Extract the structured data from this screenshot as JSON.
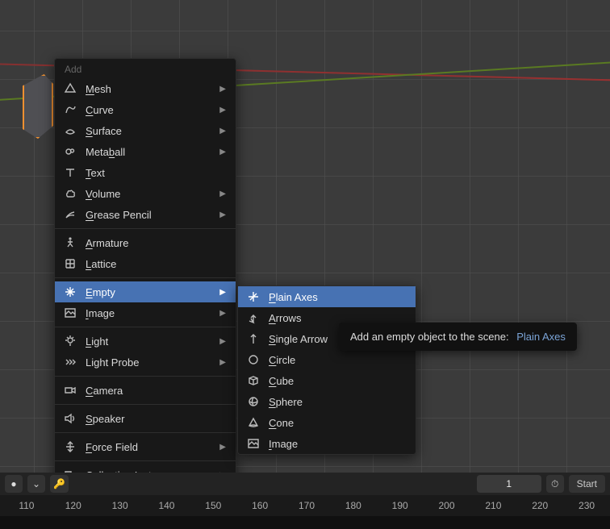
{
  "menu": {
    "title": "Add",
    "groups": [
      [
        {
          "id": "mesh",
          "label": "Mesh",
          "accel": "M",
          "icon": "mesh",
          "submenu": true
        },
        {
          "id": "curve",
          "label": "Curve",
          "accel": "C",
          "icon": "curve",
          "submenu": true
        },
        {
          "id": "surface",
          "label": "Surface",
          "accel": "S",
          "icon": "surface",
          "submenu": true
        },
        {
          "id": "metaball",
          "label": "Metaball",
          "accel": "b",
          "icon": "metaball",
          "submenu": true
        },
        {
          "id": "text",
          "label": "Text",
          "accel": "T",
          "icon": "text",
          "submenu": false
        },
        {
          "id": "volume",
          "label": "Volume",
          "accel": "V",
          "icon": "volume",
          "submenu": true
        },
        {
          "id": "grease",
          "label": "Grease Pencil",
          "accel": "G",
          "icon": "grease",
          "submenu": true
        }
      ],
      [
        {
          "id": "armature",
          "label": "Armature",
          "accel": "A",
          "icon": "armature",
          "submenu": false
        },
        {
          "id": "lattice",
          "label": "Lattice",
          "accel": "L",
          "icon": "lattice",
          "submenu": false
        }
      ],
      [
        {
          "id": "empty",
          "label": "Empty",
          "accel": "E",
          "icon": "empty",
          "submenu": true,
          "highlight": true
        },
        {
          "id": "image",
          "label": "Image",
          "accel": "I",
          "icon": "image",
          "submenu": true
        }
      ],
      [
        {
          "id": "light",
          "label": "Light",
          "accel": "L",
          "icon": "light",
          "submenu": true
        },
        {
          "id": "lightprobe",
          "label": "Light Probe",
          "accel": "",
          "icon": "lightprobe",
          "submenu": true
        }
      ],
      [
        {
          "id": "camera",
          "label": "Camera",
          "accel": "C",
          "icon": "camera",
          "submenu": false
        }
      ],
      [
        {
          "id": "speaker",
          "label": "Speaker",
          "accel": "S",
          "icon": "speaker",
          "submenu": false
        }
      ],
      [
        {
          "id": "forcefield",
          "label": "Force Field",
          "accel": "F",
          "icon": "force",
          "submenu": true
        }
      ],
      [
        {
          "id": "collection",
          "label": "Collection Instance",
          "accel": "",
          "icon": "collection",
          "submenu": true
        }
      ]
    ]
  },
  "submenu": {
    "items": [
      {
        "id": "plain-axes",
        "label": "Plain Axes",
        "accel": "P",
        "icon": "plainaxes",
        "highlight": true
      },
      {
        "id": "arrows",
        "label": "Arrows",
        "accel": "A",
        "icon": "arrows"
      },
      {
        "id": "single-arrow",
        "label": "Single Arrow",
        "accel": "S",
        "icon": "singlearrow"
      },
      {
        "id": "circle",
        "label": "Circle",
        "accel": "C",
        "icon": "circle"
      },
      {
        "id": "cube",
        "label": "Cube",
        "accel": "C",
        "icon": "cube"
      },
      {
        "id": "sphere",
        "label": "Sphere",
        "accel": "S",
        "icon": "sphere"
      },
      {
        "id": "cone",
        "label": "Cone",
        "accel": "C",
        "icon": "cone"
      },
      {
        "id": "image",
        "label": "Image",
        "accel": "I",
        "icon": "image"
      }
    ]
  },
  "tooltip": {
    "text": "Add an empty object to the scene:",
    "highlight": "Plain Axes"
  },
  "bottombar": {
    "record_state": "●",
    "dropdown_chevron": "⌄",
    "keying_icon": "🔑",
    "frame_current": "1",
    "clock_icon": "⏱",
    "start_label": "Start"
  },
  "ruler": {
    "ticks": [
      "110",
      "120",
      "130",
      "140",
      "150",
      "160",
      "170",
      "180",
      "190",
      "200",
      "210",
      "220",
      "230"
    ]
  }
}
